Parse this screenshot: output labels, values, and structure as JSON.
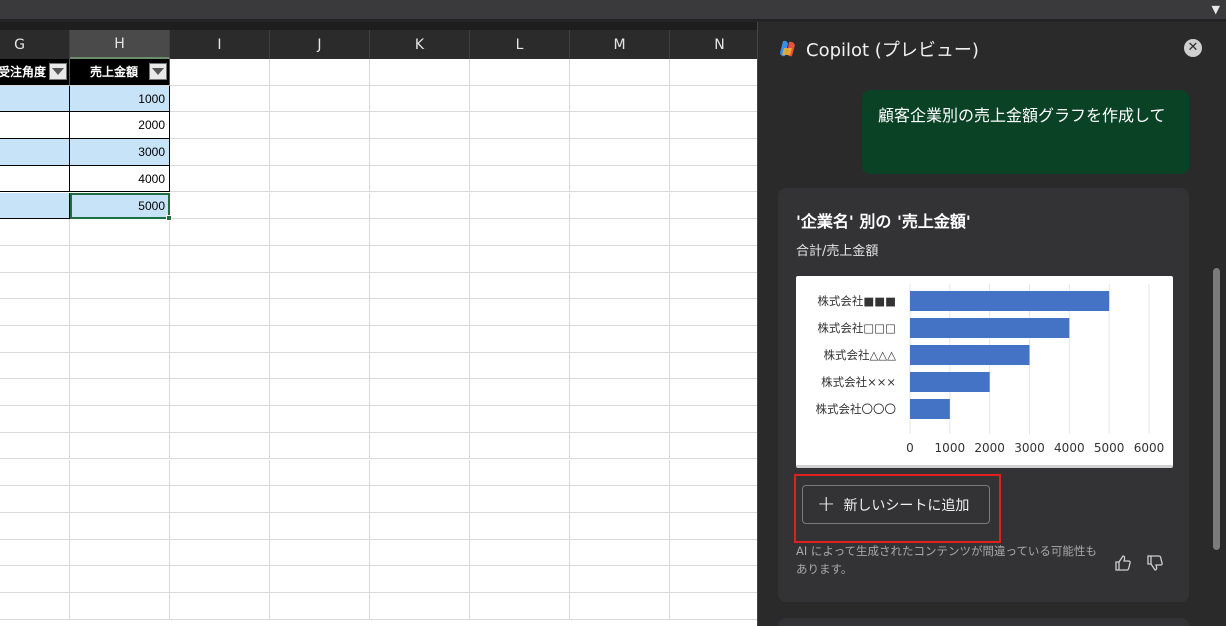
{
  "sheet": {
    "columns": [
      "G",
      "H",
      "I",
      "J",
      "K",
      "L",
      "M",
      "N"
    ],
    "header_g": "受注角度",
    "header_h": "売上金額",
    "values": [
      "1000",
      "2000",
      "3000",
      "4000",
      "5000"
    ]
  },
  "copilot": {
    "title": "Copilot (プレビュー)",
    "user_message": "顧客企業別の売上金額グラフを作成して",
    "card_title": "'企業名' 別の '売上金額'",
    "card_subtitle": "合計/売上金額",
    "add_button": "新しいシートに追加",
    "disclaimer": "AI によって生成されたコンテンツが間違っている可能性もあります。"
  },
  "chart_data": {
    "type": "bar",
    "orientation": "horizontal",
    "categories": [
      "株式会社■■■",
      "株式会社□□□",
      "株式会社△△△",
      "株式会社×××",
      "株式会社〇〇〇"
    ],
    "values": [
      5000,
      4000,
      3000,
      2000,
      1000
    ],
    "xlim": [
      0,
      6000
    ],
    "xticks": [
      "0",
      "1000",
      "2000",
      "3000",
      "4000",
      "5000",
      "6000"
    ],
    "bar_color": "#4472c4",
    "grid": true
  },
  "colors": {
    "selected_row": "#c7e3f7",
    "user_bubble": "#0a4226",
    "highlight": "#e0201c"
  }
}
